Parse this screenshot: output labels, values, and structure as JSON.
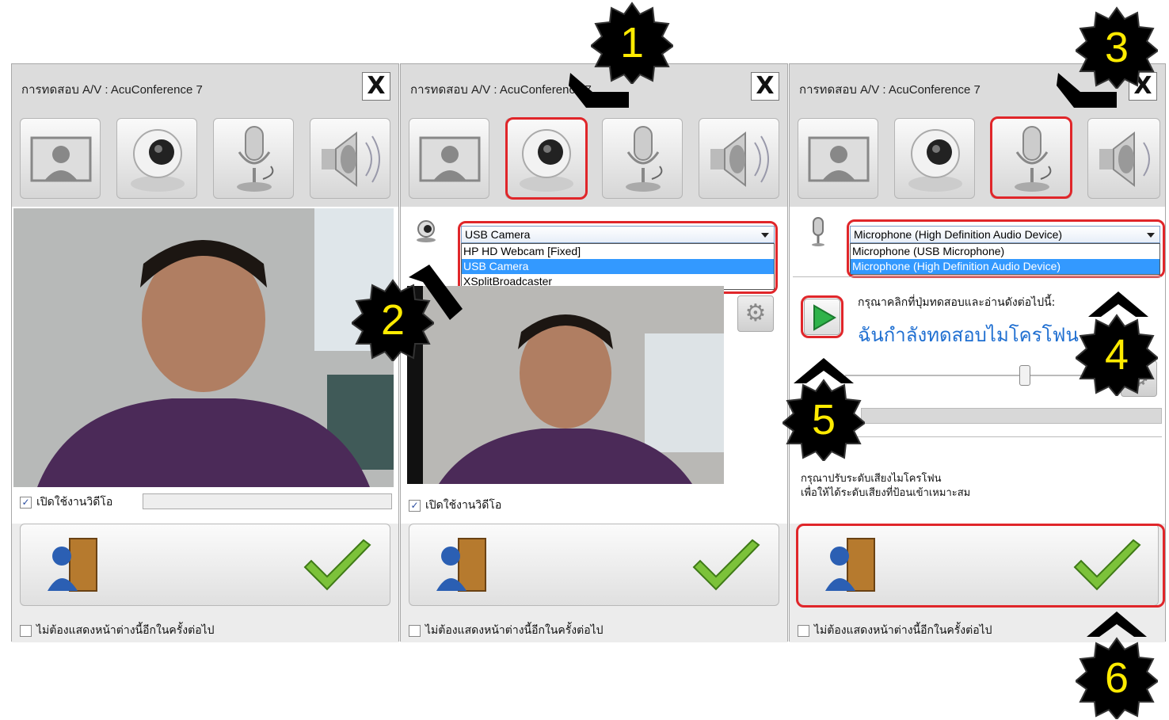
{
  "window_title": "การทดสอบ A/V : AcuConference 7",
  "close_label": "X",
  "enable_video_label": "เปิดใช้งานวิดีโอ",
  "dont_show_label": "ไม่ต้องแสดงหน้าต่างนี้อีกในครั้งต่อไป",
  "camera_selected": "USB Camera",
  "camera_options": [
    "HP HD Webcam [Fixed]",
    "USB Camera",
    "XSplitBroadcaster"
  ],
  "mic_selected": "Microphone (High Definition Audio Device)",
  "mic_options": [
    "Microphone (USB Microphone)",
    "Microphone (High Definition Audio Device)"
  ],
  "mic_instruction": "กรุณาคลิกที่ปุ่มทดสอบและอ่านดังต่อไปนี้:",
  "mic_test_phrase": "ฉันกำลังทดสอบไมโครโฟน",
  "mic_adjust_line1": "กรุณาปรับระดับเสียงไมโครโฟน",
  "mic_adjust_line2": "เพื่อให้ได้ระดับเสียงที่ป้อนเข้าเหมาะสม",
  "badges": [
    "1",
    "2",
    "3",
    "4",
    "5",
    "6"
  ],
  "colors": {
    "highlight": "#e0262a",
    "badge_fill": "#000000",
    "badge_text": "#ffeb00",
    "selection": "#3399ff"
  },
  "icons": [
    "screen-icon",
    "webcam-icon",
    "microphone-icon",
    "speaker-icon",
    "exit-door-icon",
    "checkmark-icon",
    "gear-icon",
    "play-icon"
  ]
}
